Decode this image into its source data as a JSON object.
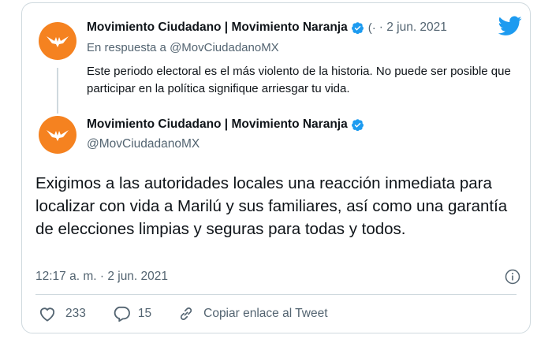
{
  "reply": {
    "name": "Movimiento Ciudadano | Movimiento Naranja",
    "handle_fragment": "(·",
    "date": "· 2 jun. 2021",
    "in_reply_to": "En respuesta a @MovCiudadanoMX",
    "text": "Este periodo electoral es el más violento de la historia. No puede ser posible que participar en la política signifique arriesgar tu vida."
  },
  "tweet": {
    "name": "Movimiento Ciudadano | Movimiento Naranja",
    "handle": "@MovCiudadanoMX",
    "text": "Exigimos a las autoridades locales una reacción inmediata para localizar con vida a Marilú y sus familiares, así como una garantía de elecciones limpias y seguras para todas y todos.",
    "timestamp": "12:17 a. m. · 2 jun. 2021",
    "likes": "233",
    "replies": "15",
    "copy_link_label": "Copiar enlace al Tweet"
  },
  "colors": {
    "brand_orange": "#f58220",
    "twitter_blue": "#1d9bf0",
    "muted": "#536471",
    "border": "#cfd9de"
  },
  "icons": [
    "bird-icon",
    "verified-icon",
    "heart-icon",
    "reply-icon",
    "link-icon",
    "info-icon",
    "eagle-logo"
  ]
}
